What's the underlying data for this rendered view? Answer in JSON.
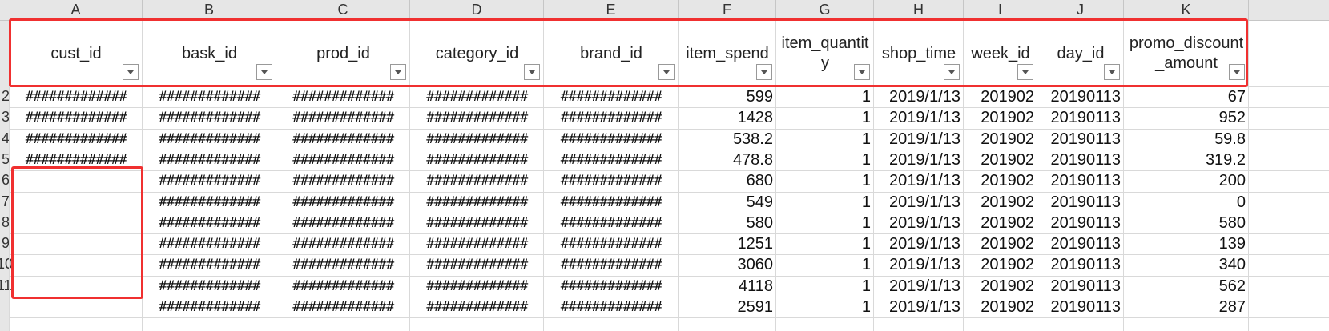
{
  "column_letters": [
    "A",
    "B",
    "C",
    "D",
    "E",
    "F",
    "G",
    "H",
    "I",
    "J",
    "K"
  ],
  "headers": [
    "cust_id",
    "bask_id",
    "prod_id",
    "category_id",
    "brand_id",
    "item_spend",
    "item_quantity",
    "shop_time",
    "week_id",
    "day_id",
    "promo_discount_amount"
  ],
  "row_numbers": [
    "2",
    "3",
    "4",
    "5",
    "6",
    "7",
    "8",
    "9",
    "10",
    "11",
    ""
  ],
  "hash_text": "#############",
  "rows": [
    {
      "a_filled": true,
      "item_spend": "599",
      "item_quantity": "1",
      "shop_time": "2019/1/13",
      "week_id": "201902",
      "day_id": "20190113",
      "promo": "67"
    },
    {
      "a_filled": true,
      "item_spend": "1428",
      "item_quantity": "1",
      "shop_time": "2019/1/13",
      "week_id": "201902",
      "day_id": "20190113",
      "promo": "952"
    },
    {
      "a_filled": true,
      "item_spend": "538.2",
      "item_quantity": "1",
      "shop_time": "2019/1/13",
      "week_id": "201902",
      "day_id": "20190113",
      "promo": "59.8"
    },
    {
      "a_filled": true,
      "item_spend": "478.8",
      "item_quantity": "1",
      "shop_time": "2019/1/13",
      "week_id": "201902",
      "day_id": "20190113",
      "promo": "319.2"
    },
    {
      "a_filled": false,
      "item_spend": "680",
      "item_quantity": "1",
      "shop_time": "2019/1/13",
      "week_id": "201902",
      "day_id": "20190113",
      "promo": "200"
    },
    {
      "a_filled": false,
      "item_spend": "549",
      "item_quantity": "1",
      "shop_time": "2019/1/13",
      "week_id": "201902",
      "day_id": "20190113",
      "promo": "0"
    },
    {
      "a_filled": false,
      "item_spend": "580",
      "item_quantity": "1",
      "shop_time": "2019/1/13",
      "week_id": "201902",
      "day_id": "20190113",
      "promo": "580"
    },
    {
      "a_filled": false,
      "item_spend": "1251",
      "item_quantity": "1",
      "shop_time": "2019/1/13",
      "week_id": "201902",
      "day_id": "20190113",
      "promo": "139"
    },
    {
      "a_filled": false,
      "item_spend": "3060",
      "item_quantity": "1",
      "shop_time": "2019/1/13",
      "week_id": "201902",
      "day_id": "20190113",
      "promo": "340"
    },
    {
      "a_filled": false,
      "item_spend": "4118",
      "item_quantity": "1",
      "shop_time": "2019/1/13",
      "week_id": "201902",
      "day_id": "20190113",
      "promo": "562"
    },
    {
      "a_filled": false,
      "item_spend": "2591",
      "item_quantity": "1",
      "shop_time": "2019/1/13",
      "week_id": "201902",
      "day_id": "20190113",
      "promo": "287"
    }
  ],
  "colors": {
    "highlight": "#f03030",
    "header_bg": "#e6e6e6",
    "grid": "#d9d9d9"
  }
}
